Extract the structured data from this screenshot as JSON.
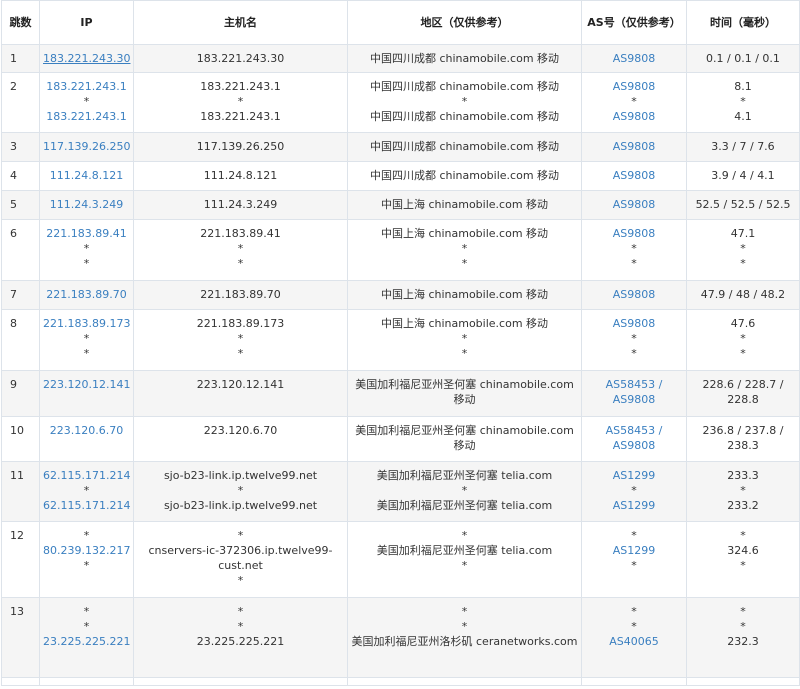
{
  "headers": [
    "跳数",
    "IP",
    "主机名",
    "地区（仅供参考）",
    "AS号（仅供参考）",
    "时间（毫秒）"
  ],
  "rows": [
    {
      "hop": "1",
      "ip": [
        "183.221.243.30"
      ],
      "host": [
        "183.221.243.30"
      ],
      "region": [
        "中国四川成都 chinamobile.com 移动"
      ],
      "as": [
        "AS9808"
      ],
      "time": [
        "0.1 / 0.1 / 0.1"
      ]
    },
    {
      "hop": "2",
      "ip": [
        "183.221.243.1",
        "*",
        "183.221.243.1"
      ],
      "host": [
        "183.221.243.1",
        "*",
        "183.221.243.1"
      ],
      "region": [
        "中国四川成都 chinamobile.com 移动",
        "*",
        "中国四川成都 chinamobile.com 移动"
      ],
      "as": [
        "AS9808",
        "*",
        "AS9808"
      ],
      "time": [
        "8.1",
        "*",
        "4.1"
      ]
    },
    {
      "hop": "3",
      "ip": [
        "117.139.26.250"
      ],
      "host": [
        "117.139.26.250"
      ],
      "region": [
        "中国四川成都 chinamobile.com 移动"
      ],
      "as": [
        "AS9808"
      ],
      "time": [
        "3.3 / 7 / 7.6"
      ]
    },
    {
      "hop": "4",
      "ip": [
        "111.24.8.121"
      ],
      "host": [
        "111.24.8.121"
      ],
      "region": [
        "中国四川成都 chinamobile.com 移动"
      ],
      "as": [
        "AS9808"
      ],
      "time": [
        "3.9 / 4 / 4.1"
      ]
    },
    {
      "hop": "5",
      "ip": [
        "111.24.3.249"
      ],
      "host": [
        "111.24.3.249"
      ],
      "region": [
        "中国上海 chinamobile.com 移动"
      ],
      "as": [
        "AS9808"
      ],
      "time": [
        "52.5 / 52.5 / 52.5"
      ]
    },
    {
      "hop": "6",
      "ip": [
        "221.183.89.41",
        "*",
        "*"
      ],
      "host": [
        "221.183.89.41",
        "*",
        "*"
      ],
      "region": [
        "中国上海 chinamobile.com 移动",
        "*",
        "*"
      ],
      "as": [
        "AS9808",
        "*",
        "*"
      ],
      "time": [
        "47.1",
        "*",
        "*"
      ]
    },
    {
      "hop": "7",
      "ip": [
        "221.183.89.70"
      ],
      "host": [
        "221.183.89.70"
      ],
      "region": [
        "中国上海 chinamobile.com 移动"
      ],
      "as": [
        "AS9808"
      ],
      "time": [
        "47.9 / 48 / 48.2"
      ]
    },
    {
      "hop": "8",
      "ip": [
        "221.183.89.173",
        "*",
        "*"
      ],
      "host": [
        "221.183.89.173",
        "*",
        "*"
      ],
      "region": [
        "中国上海 chinamobile.com 移动",
        "*",
        "*"
      ],
      "as": [
        "AS9808",
        "*",
        "*"
      ],
      "time": [
        "47.6",
        "*",
        "*"
      ]
    },
    {
      "hop": "9",
      "ip": [
        "223.120.12.141"
      ],
      "host": [
        "223.120.12.141"
      ],
      "region": [
        "美国加利福尼亚州圣何塞 chinamobile.com 移动"
      ],
      "as": [
        "AS58453 / AS9808"
      ],
      "time": [
        "228.6 / 228.7 / 228.8"
      ]
    },
    {
      "hop": "10",
      "ip": [
        "223.120.6.70"
      ],
      "host": [
        "223.120.6.70"
      ],
      "region": [
        "美国加利福尼亚州圣何塞 chinamobile.com 移动"
      ],
      "as": [
        "AS58453 / AS9808"
      ],
      "time": [
        "236.8 / 237.8 / 238.3"
      ]
    },
    {
      "hop": "11",
      "ip": [
        "62.115.171.214",
        "*",
        "62.115.171.214"
      ],
      "host": [
        "sjo-b23-link.ip.twelve99.net",
        "*",
        "sjo-b23-link.ip.twelve99.net"
      ],
      "region": [
        "美国加利福尼亚州圣何塞 telia.com",
        "*",
        "美国加利福尼亚州圣何塞 telia.com"
      ],
      "as": [
        "AS1299",
        "*",
        "AS1299"
      ],
      "time": [
        "233.3",
        "*",
        "233.2"
      ]
    },
    {
      "hop": "12",
      "ip": [
        "*",
        "80.239.132.217",
        "*"
      ],
      "host": [
        "*",
        "cnservers-ic-372306.ip.twelve99-cust.net",
        "*"
      ],
      "region": [
        "*",
        "美国加利福尼亚州圣何塞 telia.com",
        "*"
      ],
      "as": [
        "*",
        "AS1299",
        "*"
      ],
      "time": [
        "*",
        "324.6",
        "*"
      ]
    },
    {
      "hop": "13",
      "ip": [
        "*",
        "*",
        "23.225.225.221"
      ],
      "host": [
        "*",
        "*",
        "23.225.225.221"
      ],
      "region": [
        "*",
        "*",
        "美国加利福尼亚州洛杉矶 ceranetworks.com"
      ],
      "as": [
        "*",
        "*",
        "AS40065"
      ],
      "time": [
        "*",
        "*",
        "232.3"
      ]
    },
    {
      "hop": "",
      "ip": [],
      "host": [],
      "region": [],
      "as": [],
      "time": []
    }
  ],
  "colors": {
    "link": "#3a7fc0",
    "row_alt": "#f5f5f5",
    "border": "#dde3ea"
  }
}
